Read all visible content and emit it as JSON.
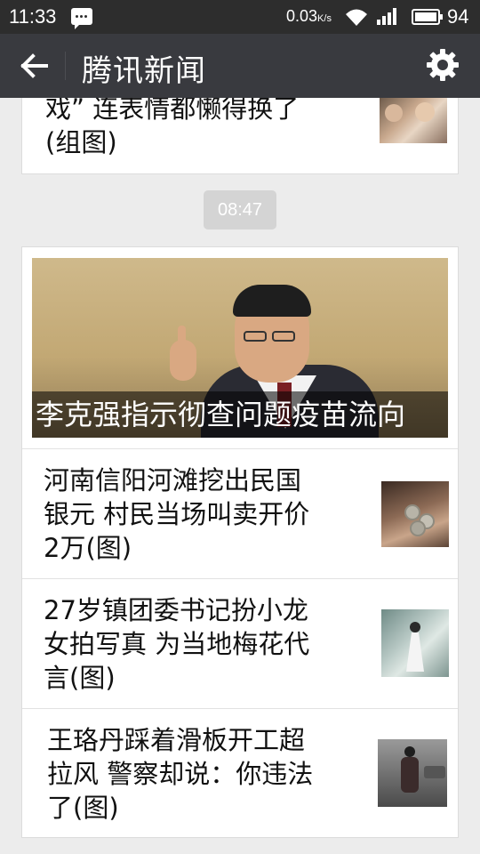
{
  "status_bar": {
    "time": "11:33",
    "speed_value": "0.03",
    "speed_unit": "K/s",
    "battery_level": "94"
  },
  "title_bar": {
    "title": "腾讯新闻"
  },
  "top_item": {
    "line1": "戏” 连表情都懒得换了",
    "line2": "(组图)"
  },
  "time_badge": "08:47",
  "headline": {
    "caption": "李克强指示彻查问题疫苗流向"
  },
  "items": [
    {
      "line1": "河南信阳河滩挖出民国",
      "line2": "银元 村民当场叫卖开价",
      "line3": "2万(图)"
    },
    {
      "line1": "27岁镇团委书记扮小龙",
      "line2": "女拍写真 为当地梅花代",
      "line3": "言(图)"
    },
    {
      "line1": "王珞丹踩着滑板开工超",
      "line2": "拉风 警察却说：你违法",
      "line3": "了(图)"
    }
  ],
  "colors": {
    "title_bar": "#393a3f",
    "status_bar": "#2d2d2d",
    "background": "#ececec"
  },
  "icons": {
    "back": "arrow-left-icon",
    "settings": "gear-icon"
  }
}
